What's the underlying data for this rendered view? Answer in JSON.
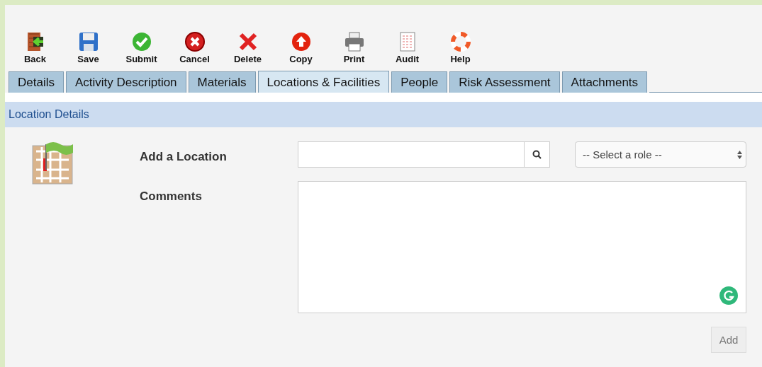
{
  "toolbar": [
    {
      "kind": "back",
      "label": "Back"
    },
    {
      "kind": "save",
      "label": "Save"
    },
    {
      "kind": "submit",
      "label": "Submit"
    },
    {
      "kind": "cancel",
      "label": "Cancel"
    },
    {
      "kind": "delete",
      "label": "Delete"
    },
    {
      "kind": "copy",
      "label": "Copy"
    },
    {
      "kind": "print",
      "label": "Print"
    },
    {
      "kind": "audit",
      "label": "Audit"
    },
    {
      "kind": "help",
      "label": "Help"
    }
  ],
  "tabs": [
    {
      "label": "Details",
      "selected": false
    },
    {
      "label": "Activity Description",
      "selected": false
    },
    {
      "label": "Materials",
      "selected": false
    },
    {
      "label": "Locations & Facilities",
      "selected": true
    },
    {
      "label": "People",
      "selected": false
    },
    {
      "label": "Risk Assessment",
      "selected": false
    },
    {
      "label": "Attachments",
      "selected": false
    }
  ],
  "section": {
    "title": "Location Details"
  },
  "form": {
    "location_label": "Add a Location",
    "role_select": "-- Select a role --",
    "comments_label": "Comments",
    "add_button": "Add"
  }
}
